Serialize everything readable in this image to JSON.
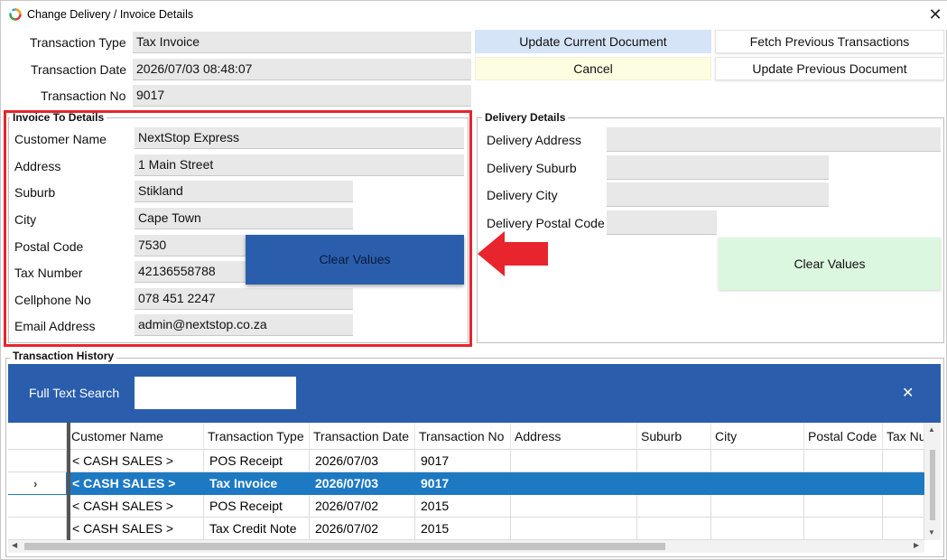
{
  "window": {
    "title": "Change Delivery / Invoice Details"
  },
  "transaction": {
    "type_label": "Transaction Type",
    "type_value": "Tax Invoice",
    "date_label": "Transaction Date",
    "date_value": "2026/07/03 08:48:07",
    "no_label": "Transaction No",
    "no_value": "9017"
  },
  "buttons": {
    "update_current": "Update Current Document",
    "fetch_previous": "Fetch Previous Transactions",
    "cancel": "Cancel",
    "update_previous": "Update Previous Document"
  },
  "invoice": {
    "legend": "Invoice To Details",
    "fields": [
      {
        "label": "Customer Name",
        "value": "NextStop Express"
      },
      {
        "label": "Address",
        "value": "1 Main Street"
      },
      {
        "label": "Suburb",
        "value": "Stikland"
      },
      {
        "label": "City",
        "value": "Cape Town"
      },
      {
        "label": "Postal Code",
        "value": "7530"
      },
      {
        "label": "Tax Number",
        "value": "42136558788"
      },
      {
        "label": "Cellphone No",
        "value": "078 451 2247"
      },
      {
        "label": "Email Address",
        "value": "admin@nextstop.co.za"
      }
    ],
    "clear_label": "Clear Values"
  },
  "delivery": {
    "legend": "Delivery Details",
    "fields": [
      {
        "label": "Delivery Address",
        "value": ""
      },
      {
        "label": "Delivery Suburb",
        "value": ""
      },
      {
        "label": "Delivery City",
        "value": ""
      },
      {
        "label": "Delivery Postal Code",
        "value": ""
      }
    ],
    "clear_label": "Clear Values"
  },
  "history": {
    "legend": "Transaction History",
    "search_label": "Full Text Search",
    "search_value": "",
    "columns": [
      "Customer Name",
      "Transaction Type",
      "Transaction Date",
      "Transaction No",
      "Address",
      "Suburb",
      "City",
      "Postal Code",
      "Tax Nu"
    ],
    "rows": [
      {
        "customer": "< CASH SALES >",
        "type": "POS Receipt",
        "date": "2026/07/03",
        "no": "9017",
        "selected": false
      },
      {
        "customer": "< CASH SALES >",
        "type": "Tax Invoice",
        "date": "2026/07/03",
        "no": "9017",
        "selected": true
      },
      {
        "customer": "< CASH SALES >",
        "type": "POS Receipt",
        "date": "2026/07/02",
        "no": "2015",
        "selected": false
      },
      {
        "customer": "< CASH SALES >",
        "type": "Tax Credit Note",
        "date": "2026/07/02",
        "no": "2015",
        "selected": false
      }
    ]
  },
  "colors": {
    "highlight_red": "#e8242c",
    "header_blue": "#2a5eac",
    "selected_row": "#1e79c3",
    "clear_green": "#dbf7df"
  }
}
